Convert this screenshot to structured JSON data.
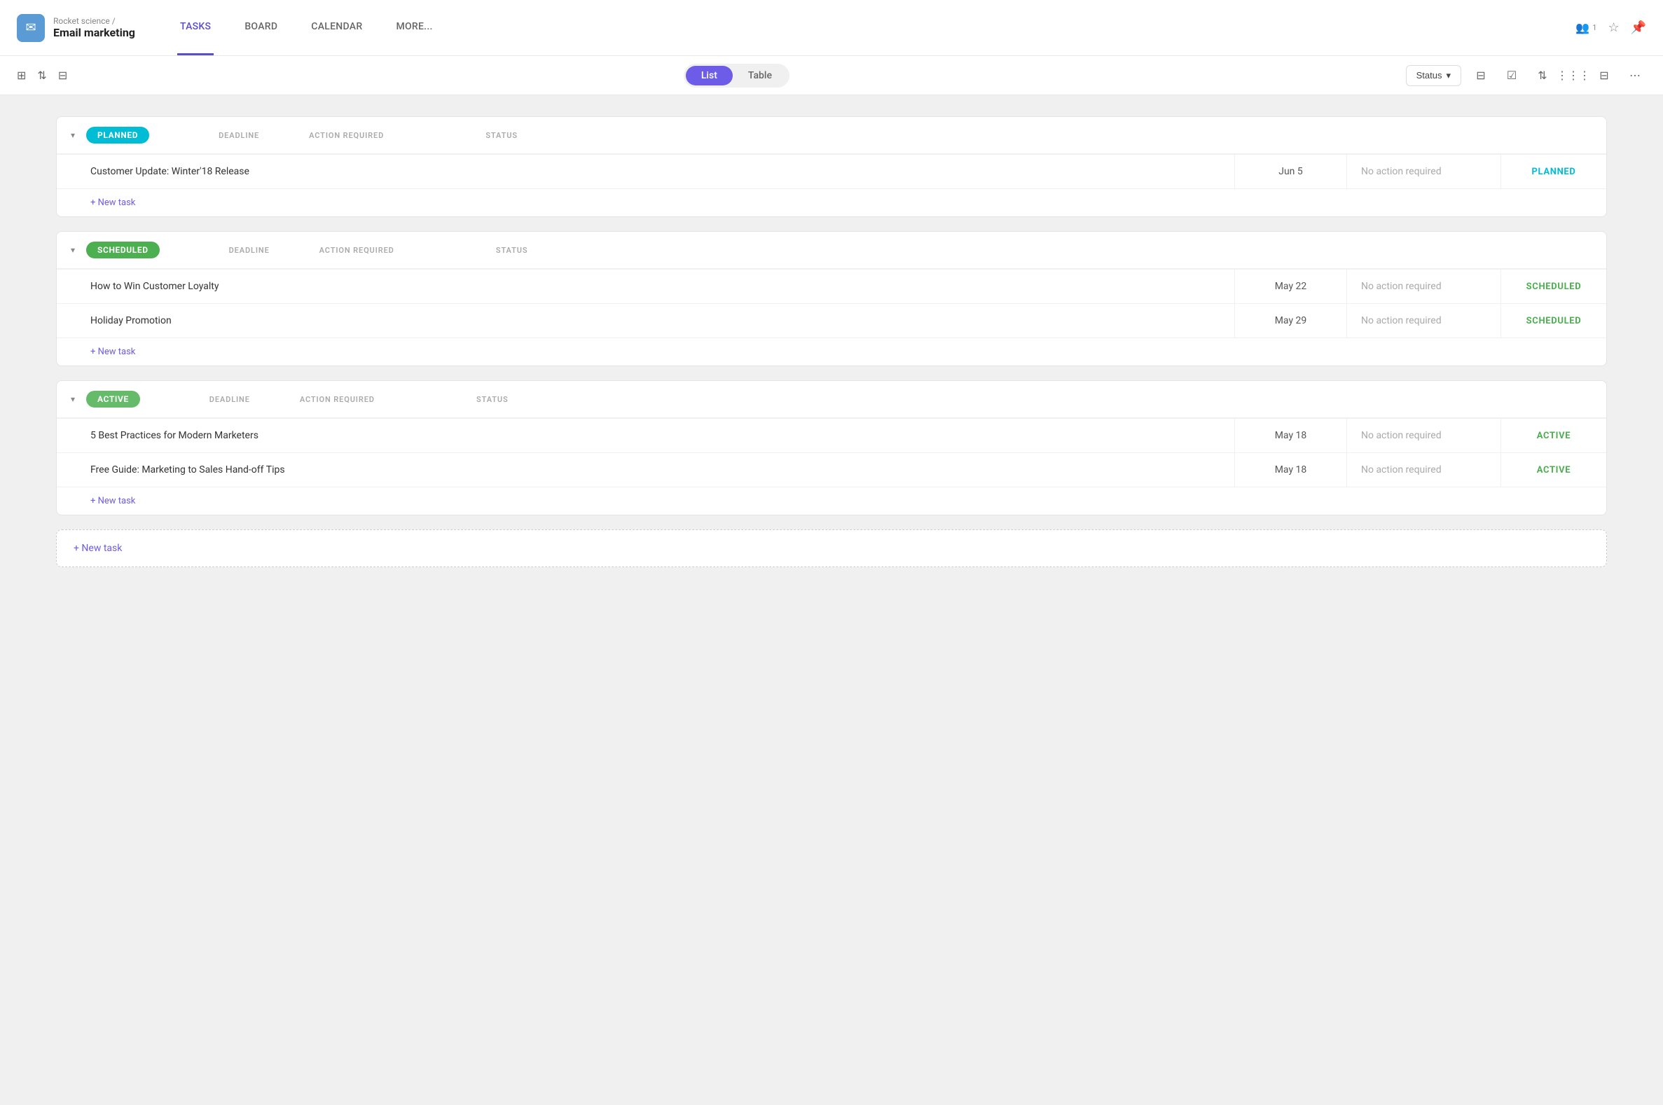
{
  "header": {
    "logo_icon": "✉",
    "parent_label": "Rocket science /",
    "project_name": "Email marketing",
    "nav_items": [
      {
        "id": "tasks",
        "label": "TASKS",
        "active": true
      },
      {
        "id": "board",
        "label": "BOARD",
        "active": false
      },
      {
        "id": "calendar",
        "label": "CALENDAR",
        "active": false
      },
      {
        "id": "more",
        "label": "MORE...",
        "active": false
      }
    ],
    "users_count": "1",
    "star_icon": "☆",
    "pin_icon": "📌"
  },
  "toolbar": {
    "view_options": [
      {
        "id": "list",
        "label": "List",
        "active": true
      },
      {
        "id": "table",
        "label": "Table",
        "active": false
      }
    ],
    "status_button_label": "Status",
    "status_button_icon": "▾"
  },
  "task_groups": [
    {
      "id": "planned",
      "label": "PLANNED",
      "type": "planned",
      "columns": {
        "deadline": "DEADLINE",
        "action_required": "ACTION REQUIRED",
        "status": "STATUS"
      },
      "tasks": [
        {
          "name": "Customer Update: Winter'18 Release",
          "deadline": "Jun 5",
          "action_required": "No action required",
          "status": "PLANNED",
          "status_type": "planned"
        }
      ],
      "new_task_label": "+ New task"
    },
    {
      "id": "scheduled",
      "label": "SCHEDULED",
      "type": "scheduled",
      "columns": {
        "deadline": "DEADLINE",
        "action_required": "ACTION REQUIRED",
        "status": "STATUS"
      },
      "tasks": [
        {
          "name": "How to Win Customer Loyalty",
          "deadline": "May 22",
          "action_required": "No action required",
          "status": "SCHEDULED",
          "status_type": "scheduled"
        },
        {
          "name": "Holiday Promotion",
          "deadline": "May 29",
          "action_required": "No action required",
          "status": "SCHEDULED",
          "status_type": "scheduled"
        }
      ],
      "new_task_label": "+ New task"
    },
    {
      "id": "active",
      "label": "ACTIVE",
      "type": "active",
      "columns": {
        "deadline": "DEADLINE",
        "action_required": "ACTION REQUIRED",
        "status": "STATUS"
      },
      "tasks": [
        {
          "name": "5 Best Practices for Modern Marketers",
          "deadline": "May 18",
          "action_required": "No action required",
          "status": "ACTIVE",
          "status_type": "active"
        },
        {
          "name": "Free Guide: Marketing to Sales Hand-off Tips",
          "deadline": "May 18",
          "action_required": "No action required",
          "status": "ACTIVE",
          "status_type": "active"
        }
      ],
      "new_task_label": "+ New task"
    }
  ],
  "bottom_new_task_label": "+ New task"
}
